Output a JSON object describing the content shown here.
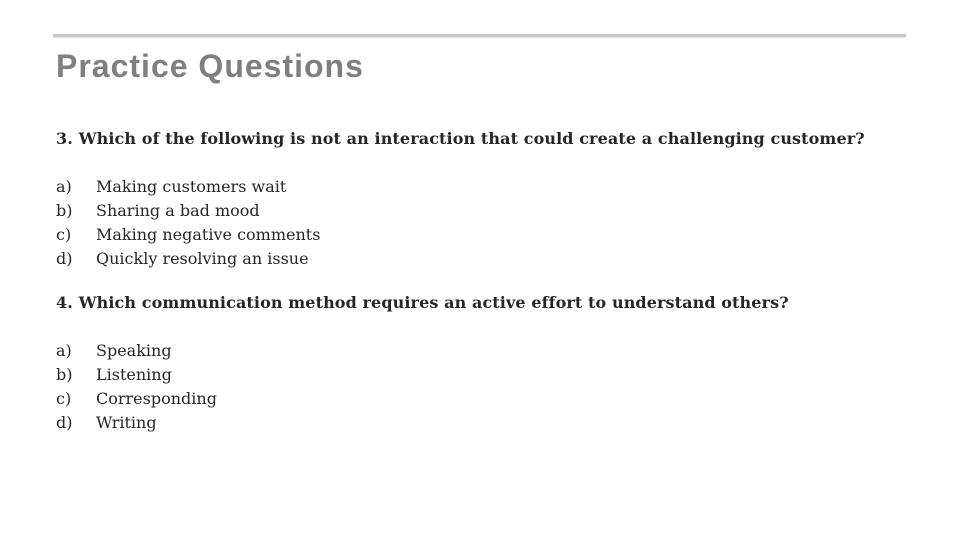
{
  "slide": {
    "title": "Practice Questions",
    "questions": [
      {
        "number": "3.",
        "text": "3. Which of the following is not an interaction that could create a challenging customer?",
        "options": [
          {
            "letter": "a)",
            "text": "Making customers wait"
          },
          {
            "letter": "b)",
            "text": "Sharing a bad mood"
          },
          {
            "letter": "c)",
            "text": "Making negative comments"
          },
          {
            "letter": "d)",
            "text": "Quickly resolving an issue"
          }
        ]
      },
      {
        "number": "4.",
        "text": "4. Which communication method requires an active effort to understand others?",
        "options": [
          {
            "letter": "a)",
            "text": "Speaking"
          },
          {
            "letter": "b)",
            "text": "Listening"
          },
          {
            "letter": "c)",
            "text": "Corresponding"
          },
          {
            "letter": "d)",
            "text": "Writing"
          }
        ]
      }
    ]
  },
  "colors": {
    "title": "#7f7f7f",
    "body_text": "#262626",
    "rule": "#c8c8c8",
    "background": "#ffffff"
  }
}
